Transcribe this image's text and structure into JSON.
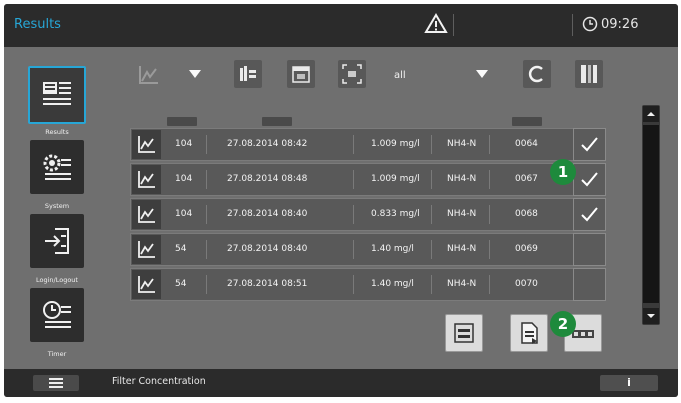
{
  "header": {
    "title": "Results",
    "time": "09:26"
  },
  "nav": [
    {
      "label": "Results",
      "icon": "results-list-icon",
      "active": true
    },
    {
      "label": "System",
      "icon": "system-gears-icon",
      "active": false
    },
    {
      "label": "Login/Logout",
      "icon": "login-logout-icon",
      "active": false
    },
    {
      "label": "Timer",
      "icon": "timer-icon",
      "active": false
    }
  ],
  "toolbar": {
    "filter_value": "all",
    "tools": [
      "chart-icon",
      "method-icon",
      "calendar-icon",
      "id-icon",
      "refresh-icon",
      "column-select-icon"
    ]
  },
  "table": {
    "rows": [
      {
        "method": "104",
        "datetime": "27.08.2014 08:42",
        "value": "1.009 mg/l",
        "parameter": "NH4-N",
        "id": "0064",
        "checked": true
      },
      {
        "method": "104",
        "datetime": "27.08.2014 08:48",
        "value": "1.009 mg/l",
        "parameter": "NH4-N",
        "id": "0067",
        "checked": true
      },
      {
        "method": "104",
        "datetime": "27.08.2014 08:40",
        "value": "0.833 mg/l",
        "parameter": "NH4-N",
        "id": "0068",
        "checked": true
      },
      {
        "method": "54",
        "datetime": "27.08.2014 08:40",
        "value": "1.40 mg/l",
        "parameter": "NH4-N",
        "id": "0069",
        "checked": false
      },
      {
        "method": "54",
        "datetime": "27.08.2014 08:51",
        "value": "1.40 mg/l",
        "parameter": "NH4-N",
        "id": "0070",
        "checked": false
      }
    ]
  },
  "callouts": [
    "1",
    "2"
  ],
  "footer": {
    "status": "Filter Concentration",
    "info": "i"
  },
  "colors": {
    "accent": "#27a6d6",
    "badge": "#1e8a3c",
    "topbar": "#2b2b2b"
  }
}
